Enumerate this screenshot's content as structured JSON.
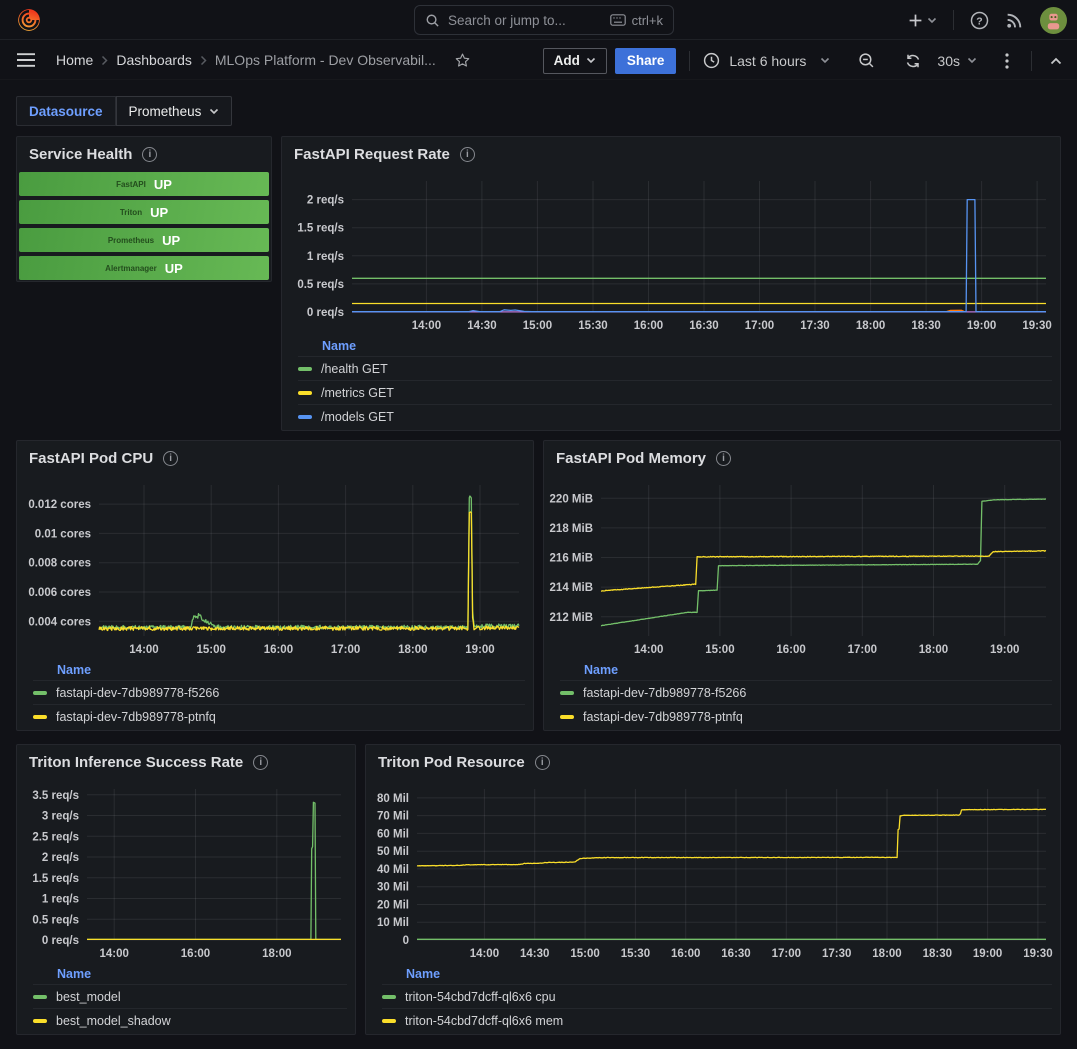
{
  "topnav": {
    "search_placeholder": "Search or jump to...",
    "search_shortcut": "ctrl+k"
  },
  "breadcrumb": {
    "home": "Home",
    "section": "Dashboards",
    "page": "MLOps Platform - Dev Observabil..."
  },
  "toolbar": {
    "add_label": "Add",
    "share_label": "Share",
    "time_range": "Last 6 hours",
    "refresh_interval": "30s"
  },
  "submenu": {
    "datasource_label": "Datasource",
    "datasource_value": "Prometheus"
  },
  "colors": {
    "green": "#73bf69",
    "yellow": "#fade2a",
    "blue": "#5794f2",
    "orange": "#ff780a",
    "purple": "#b877d9",
    "share_button": "#3d71d9",
    "link_blue": "#6e9fff"
  },
  "service_health": {
    "title": "Service Health",
    "services": [
      {
        "name": "FastAPI",
        "status": "UP"
      },
      {
        "name": "Triton",
        "status": "UP"
      },
      {
        "name": "Prometheus",
        "status": "UP"
      },
      {
        "name": "Alertmanager",
        "status": "UP"
      }
    ]
  },
  "chart_data": {
    "fastapi_request_rate": {
      "type": "line",
      "title": "FastAPI Request Rate",
      "legend_header": "Name",
      "ylabel": "req/s",
      "xlim": [
        13.33,
        19.58
      ],
      "ylim": [
        0,
        2.33
      ],
      "yticks": [
        {
          "v": 0,
          "label": "0 req/s"
        },
        {
          "v": 0.5,
          "label": "0.5 req/s"
        },
        {
          "v": 1,
          "label": "1 req/s"
        },
        {
          "v": 1.5,
          "label": "1.5 req/s"
        },
        {
          "v": 2,
          "label": "2 req/s"
        }
      ],
      "xticks": [
        {
          "v": 14,
          "label": "14:00"
        },
        {
          "v": 14.5,
          "label": "14:30"
        },
        {
          "v": 15,
          "label": "15:00"
        },
        {
          "v": 15.5,
          "label": "15:30"
        },
        {
          "v": 16,
          "label": "16:00"
        },
        {
          "v": 16.5,
          "label": "16:30"
        },
        {
          "v": 17,
          "label": "17:00"
        },
        {
          "v": 17.5,
          "label": "17:30"
        },
        {
          "v": 18,
          "label": "18:00"
        },
        {
          "v": 18.5,
          "label": "18:30"
        },
        {
          "v": 19,
          "label": "19:00"
        },
        {
          "v": 19.5,
          "label": "19:30"
        }
      ],
      "series": [
        {
          "name": "",
          "color": "#ff780a",
          "in_legend": false,
          "points": [
            [
              18.68,
              0.004
            ],
            [
              18.72,
              0.028
            ],
            [
              18.82,
              0.03
            ],
            [
              18.85,
              0.004
            ]
          ]
        },
        {
          "name": "",
          "color": "#b877d9",
          "in_legend": false,
          "points": [
            [
              13.33,
              0.002
            ],
            [
              19.58,
              0.002
            ]
          ]
        },
        {
          "name": "/health GET",
          "color": "#73bf69",
          "in_legend": true,
          "points": [
            [
              13.33,
              0.6
            ],
            [
              19.58,
              0.6
            ]
          ]
        },
        {
          "name": "/metrics GET",
          "color": "#fade2a",
          "in_legend": true,
          "points": [
            [
              13.33,
              0.152
            ],
            [
              19.58,
              0.152
            ]
          ]
        },
        {
          "name": "/models GET",
          "color": "#5794f2",
          "in_legend": true,
          "points": [
            [
              13.33,
              0.006
            ],
            [
              14.38,
              0.006
            ],
            [
              14.42,
              0.025
            ],
            [
              14.48,
              0.006
            ],
            [
              14.66,
              0.006
            ],
            [
              14.7,
              0.04
            ],
            [
              14.76,
              0.028
            ],
            [
              14.8,
              0.035
            ],
            [
              14.88,
              0.01
            ],
            [
              14.95,
              0.006
            ],
            [
              18.86,
              0.006
            ],
            [
              18.87,
              2.0
            ],
            [
              18.94,
              2.0
            ],
            [
              18.95,
              0.006
            ],
            [
              19.58,
              0.006
            ]
          ]
        }
      ]
    },
    "fastapi_pod_cpu": {
      "type": "line",
      "title": "FastAPI Pod CPU",
      "legend_header": "Name",
      "ylabel": "cores",
      "xlim": [
        13.33,
        19.58
      ],
      "ylim": [
        0.003,
        0.0133
      ],
      "yticks": [
        {
          "v": 0.004,
          "label": "0.004 cores"
        },
        {
          "v": 0.006,
          "label": "0.006 cores"
        },
        {
          "v": 0.008,
          "label": "0.008 cores"
        },
        {
          "v": 0.01,
          "label": "0.01 cores"
        },
        {
          "v": 0.012,
          "label": "0.012 cores"
        }
      ],
      "xticks": [
        {
          "v": 14,
          "label": "14:00"
        },
        {
          "v": 15,
          "label": "15:00"
        },
        {
          "v": 16,
          "label": "16:00"
        },
        {
          "v": 17,
          "label": "17:00"
        },
        {
          "v": 18,
          "label": "18:00"
        },
        {
          "v": 19,
          "label": "19:00"
        }
      ],
      "series": [
        {
          "name": "fastapi-dev-7db989778-f5266",
          "color": "#73bf69",
          "in_legend": true,
          "noise": 0.00013,
          "seed": 3,
          "points": [
            [
              13.33,
              0.00358
            ],
            [
              14.7,
              0.0036
            ],
            [
              14.74,
              0.00445
            ],
            [
              14.78,
              0.0042
            ],
            [
              14.82,
              0.00448
            ],
            [
              14.88,
              0.0041
            ],
            [
              14.96,
              0.0039
            ],
            [
              15.06,
              0.0037
            ],
            [
              15.14,
              0.0036
            ],
            [
              18.82,
              0.0036
            ],
            [
              18.84,
              0.0125
            ],
            [
              18.87,
              0.0124
            ],
            [
              18.89,
              0.0046
            ],
            [
              18.91,
              0.00368
            ],
            [
              19.58,
              0.0037
            ]
          ]
        },
        {
          "name": "fastapi-dev-7db989778-ptnfq",
          "color": "#fade2a",
          "in_legend": true,
          "noise": 0.00013,
          "seed": 7,
          "points": [
            [
              13.33,
              0.0035
            ],
            [
              14.7,
              0.00352
            ],
            [
              18.82,
              0.00352
            ],
            [
              18.84,
              0.0115
            ],
            [
              18.87,
              0.0114
            ],
            [
              18.89,
              0.0042
            ],
            [
              18.91,
              0.00355
            ],
            [
              19.58,
              0.00358
            ]
          ]
        }
      ]
    },
    "fastapi_pod_memory": {
      "type": "line",
      "title": "FastAPI Pod Memory",
      "legend_header": "Name",
      "ylabel": "MiB",
      "xlim": [
        13.33,
        19.58
      ],
      "ylim": [
        210.7,
        220.9
      ],
      "yticks": [
        {
          "v": 212,
          "label": "212 MiB"
        },
        {
          "v": 214,
          "label": "214 MiB"
        },
        {
          "v": 216,
          "label": "216 MiB"
        },
        {
          "v": 218,
          "label": "218 MiB"
        },
        {
          "v": 220,
          "label": "220 MiB"
        }
      ],
      "xticks": [
        {
          "v": 14,
          "label": "14:00"
        },
        {
          "v": 15,
          "label": "15:00"
        },
        {
          "v": 16,
          "label": "16:00"
        },
        {
          "v": 17,
          "label": "17:00"
        },
        {
          "v": 18,
          "label": "18:00"
        },
        {
          "v": 19,
          "label": "19:00"
        }
      ],
      "series": [
        {
          "name": "fastapi-dev-7db989778-f5266",
          "color": "#73bf69",
          "in_legend": true,
          "noise": 0.012,
          "seed": 2,
          "points": [
            [
              13.33,
              211.4
            ],
            [
              14.55,
              212.3
            ],
            [
              14.68,
              212.3
            ],
            [
              14.7,
              213.75
            ],
            [
              14.96,
              213.8
            ],
            [
              14.98,
              215.45
            ],
            [
              18.62,
              215.55
            ],
            [
              18.66,
              215.8
            ],
            [
              18.68,
              219.8
            ],
            [
              18.85,
              219.9
            ],
            [
              19.58,
              219.95
            ]
          ]
        },
        {
          "name": "fastapi-dev-7db989778-ptnfq",
          "color": "#fade2a",
          "in_legend": true,
          "noise": 0.022,
          "seed": 5,
          "points": [
            [
              13.33,
              213.75
            ],
            [
              14.66,
              214.2
            ],
            [
              14.68,
              216.05
            ],
            [
              18.78,
              216.1
            ],
            [
              18.84,
              216.4
            ],
            [
              19.58,
              216.45
            ]
          ]
        }
      ]
    },
    "triton_inference_success_rate": {
      "type": "line",
      "title": "Triton Inference Success Rate",
      "legend_header": "Name",
      "ylabel": "req/s",
      "xlim": [
        13.33,
        19.58
      ],
      "ylim": [
        0,
        3.64
      ],
      "yticks": [
        {
          "v": 0,
          "label": "0 req/s"
        },
        {
          "v": 0.5,
          "label": "0.5 req/s"
        },
        {
          "v": 1,
          "label": "1 req/s"
        },
        {
          "v": 1.5,
          "label": "1.5 req/s"
        },
        {
          "v": 2,
          "label": "2 req/s"
        },
        {
          "v": 2.5,
          "label": "2.5 req/s"
        },
        {
          "v": 3,
          "label": "3 req/s"
        },
        {
          "v": 3.5,
          "label": "3.5 req/s"
        }
      ],
      "xticks": [
        {
          "v": 14,
          "label": "14:00"
        },
        {
          "v": 16,
          "label": "16:00"
        },
        {
          "v": 18,
          "label": "18:00"
        }
      ],
      "series": [
        {
          "name": "best_model",
          "color": "#73bf69",
          "in_legend": true,
          "points": [
            [
              13.33,
              0.015
            ],
            [
              18.84,
              0.015
            ],
            [
              18.86,
              2.2
            ],
            [
              18.88,
              2.25
            ],
            [
              18.9,
              3.32
            ],
            [
              18.94,
              3.3
            ],
            [
              18.96,
              0.015
            ],
            [
              19.58,
              0.015
            ]
          ]
        },
        {
          "name": "best_model_shadow",
          "color": "#fade2a",
          "in_legend": true,
          "points": [
            [
              13.33,
              0.015
            ],
            [
              19.58,
              0.015
            ]
          ]
        }
      ]
    },
    "triton_pod_resource": {
      "type": "line",
      "title": "Triton Pod Resource",
      "legend_header": "Name",
      "ylabel": "Mil",
      "xlim": [
        13.33,
        19.58
      ],
      "ylim": [
        0,
        85
      ],
      "yticks": [
        {
          "v": 0,
          "label": "0"
        },
        {
          "v": 10,
          "label": "10 Mil"
        },
        {
          "v": 20,
          "label": "20 Mil"
        },
        {
          "v": 30,
          "label": "30 Mil"
        },
        {
          "v": 40,
          "label": "40 Mil"
        },
        {
          "v": 50,
          "label": "50 Mil"
        },
        {
          "v": 60,
          "label": "60 Mil"
        },
        {
          "v": 70,
          "label": "70 Mil"
        },
        {
          "v": 80,
          "label": "80 Mil"
        }
      ],
      "xticks": [
        {
          "v": 14,
          "label": "14:00"
        },
        {
          "v": 14.5,
          "label": "14:30"
        },
        {
          "v": 15,
          "label": "15:00"
        },
        {
          "v": 15.5,
          "label": "15:30"
        },
        {
          "v": 16,
          "label": "16:00"
        },
        {
          "v": 16.5,
          "label": "16:30"
        },
        {
          "v": 17,
          "label": "17:00"
        },
        {
          "v": 17.5,
          "label": "17:30"
        },
        {
          "v": 18,
          "label": "18:00"
        },
        {
          "v": 18.5,
          "label": "18:30"
        },
        {
          "v": 19,
          "label": "19:00"
        },
        {
          "v": 19.5,
          "label": "19:30"
        }
      ],
      "series": [
        {
          "name": "triton-54cbd7dcff-ql6x6 cpu",
          "color": "#73bf69",
          "in_legend": true,
          "points": [
            [
              13.33,
              0.4
            ],
            [
              19.58,
              0.4
            ]
          ]
        },
        {
          "name": "triton-54cbd7dcff-ql6x6 mem",
          "color": "#fade2a",
          "in_legend": true,
          "noise": 0.12,
          "seed": 9,
          "points": [
            [
              13.33,
              41.8
            ],
            [
              13.75,
              42.0
            ],
            [
              13.8,
              42.3
            ],
            [
              14.35,
              42.5
            ],
            [
              14.4,
              43.1
            ],
            [
              14.55,
              43.2
            ],
            [
              14.6,
              43.6
            ],
            [
              14.75,
              43.7
            ],
            [
              14.9,
              43.9
            ],
            [
              14.95,
              45.9
            ],
            [
              15.05,
              46.1
            ],
            [
              15.15,
              46.4
            ],
            [
              18.1,
              46.5
            ],
            [
              18.11,
              62
            ],
            [
              18.12,
              62.5
            ],
            [
              18.13,
              69.8
            ],
            [
              18.16,
              70.2
            ],
            [
              18.72,
              70.3
            ],
            [
              18.73,
              71
            ],
            [
              18.74,
              73.3
            ],
            [
              18.9,
              73.4
            ],
            [
              19.58,
              73.5
            ]
          ]
        }
      ]
    }
  }
}
